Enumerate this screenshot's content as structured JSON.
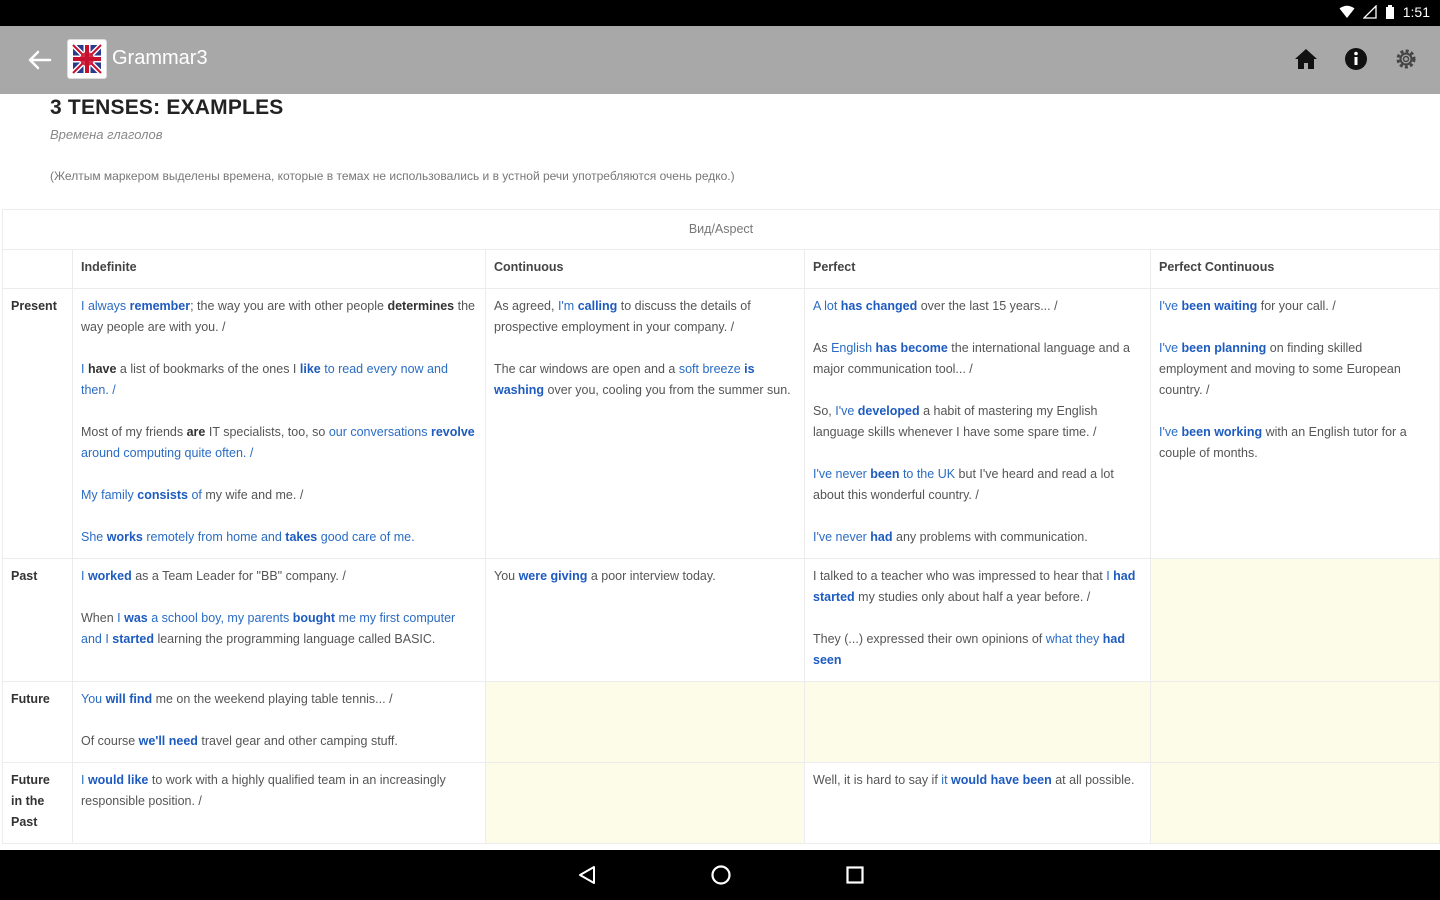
{
  "status": {
    "time": "1:51"
  },
  "appbar": {
    "title": "Grammar3"
  },
  "page": {
    "title": "3 TENSES: EXAMPLES",
    "subtitle": "Времена глаголов",
    "note": "(Желтым маркером выделены времена, которые в темах не использовались и в устной речи употребляются очень редко.)"
  },
  "table": {
    "aspect_header": "Вид/Aspect",
    "columns": [
      "Indefinite",
      "Continuous",
      "Perfect",
      "Perfect Continuous"
    ],
    "rows": [
      {
        "label": "Present",
        "cells": [
          [
            [
              [
                "b",
                "I always "
              ],
              [
                "bb",
                "remember"
              ],
              [
                "",
                "; the way you are with other people "
              ],
              [
                "k",
                "determines"
              ],
              [
                "",
                "",
                " the way people are with you. /"
              ]
            ],
            [
              [
                "b",
                "I "
              ],
              [
                "k",
                "have"
              ],
              [
                "",
                "",
                " a list of bookmarks of the ones I "
              ],
              [
                "bb",
                "like"
              ],
              [
                "b",
                " to read every now and then. /"
              ]
            ],
            [
              [
                "",
                "Most of my friends "
              ],
              [
                "k",
                "are"
              ],
              [
                "",
                "",
                " IT specialists, too, so "
              ],
              [
                "b",
                "our conversations "
              ],
              [
                "bb",
                "revolve"
              ],
              [
                "b",
                " around computing quite often. /"
              ]
            ],
            [
              [
                "b",
                "My family "
              ],
              [
                "bb",
                "consists"
              ],
              [
                "b",
                " of"
              ],
              [
                "",
                "",
                " my wife and me. /"
              ]
            ],
            [
              [
                "b",
                "She "
              ],
              [
                "bb",
                "works"
              ],
              [
                "b",
                " remotely from home and "
              ],
              [
                "bb",
                "takes"
              ],
              [
                "b",
                " good care of me."
              ]
            ]
          ],
          [
            [
              [
                "",
                "As agreed, "
              ],
              [
                "b",
                "I'm "
              ],
              [
                "bb",
                "calling"
              ],
              [
                "",
                "",
                " to discuss the details of prospective employment in your company. /"
              ]
            ],
            [
              [
                "",
                "The car windows are open and a "
              ],
              [
                "b",
                "soft breeze "
              ],
              [
                "bb",
                "is washing"
              ],
              [
                "",
                "",
                " over you, cooling you from the summer sun."
              ]
            ]
          ],
          [
            [
              [
                "b",
                "A lot "
              ],
              [
                "bb",
                "has changed"
              ],
              [
                "",
                "",
                " over the last 15 years... /"
              ]
            ],
            [
              [
                "",
                "As "
              ],
              [
                "b",
                "English "
              ],
              [
                "bb",
                "has become"
              ],
              [
                "",
                "",
                " the international language and a major communication tool... /"
              ]
            ],
            [
              [
                "",
                "So, "
              ],
              [
                "b",
                "I've "
              ],
              [
                "bb",
                "developed"
              ],
              [
                "",
                "",
                " a habit of mastering my English language skills whenever I have some spare time. /"
              ]
            ],
            [
              [
                "b",
                "I've never "
              ],
              [
                "bb",
                "been"
              ],
              [
                "b",
                " to the UK"
              ],
              [
                "",
                "",
                " but I've heard and read a lot about this wonderful country. /"
              ]
            ],
            [
              [
                "b",
                "I've never "
              ],
              [
                "bb",
                "had"
              ],
              [
                "",
                "",
                " any problems with communication."
              ]
            ]
          ],
          [
            [
              [
                "b",
                "I've "
              ],
              [
                "bb",
                "been waiting"
              ],
              [
                "",
                "",
                " for your call. /"
              ]
            ],
            [
              [
                "b",
                "I've "
              ],
              [
                "bb",
                "been planning"
              ],
              [
                "",
                "",
                " on finding skilled employment and moving to some European country. /"
              ]
            ],
            [
              [
                "b",
                "I've "
              ],
              [
                "bb",
                "been working"
              ],
              [
                "",
                "",
                " with an English tutor for a couple of months."
              ]
            ]
          ]
        ],
        "yellow": [
          false,
          false,
          false,
          false
        ]
      },
      {
        "label": "Past",
        "cells": [
          [
            [
              [
                "b",
                "I "
              ],
              [
                "bb",
                "worked"
              ],
              [
                "",
                "",
                " as a Team Leader for \"BB\" company. /"
              ]
            ],
            [
              [
                "",
                "When "
              ],
              [
                "b",
                "I "
              ],
              [
                "bb",
                "was"
              ],
              [
                "b",
                " a school boy, my parents "
              ],
              [
                "bb",
                "bought"
              ],
              [
                "b",
                " me my first computer and I "
              ],
              [
                "bb",
                "started"
              ],
              [
                "",
                "",
                " learning the programming language called BASIC."
              ]
            ]
          ],
          [
            [
              [
                "",
                "You "
              ],
              [
                "bb",
                "were giving"
              ],
              [
                "",
                "",
                " a poor interview today."
              ]
            ]
          ],
          [
            [
              [
                "",
                "I talked to a teacher who was impressed to hear that "
              ],
              [
                "b",
                "I "
              ],
              [
                "bb",
                "had started"
              ],
              [
                "",
                "",
                " my studies only about half a year before. /"
              ]
            ],
            [
              [
                "",
                "They (...) expressed their own opinions of "
              ],
              [
                "b",
                "what they "
              ],
              [
                "bb",
                "had seen"
              ]
            ]
          ],
          []
        ],
        "yellow": [
          false,
          false,
          false,
          true
        ]
      },
      {
        "label": "Future",
        "cells": [
          [
            [
              [
                "b",
                "You "
              ],
              [
                "bb",
                "will find"
              ],
              [
                "",
                "",
                " me on the weekend playing table tennis... /"
              ]
            ],
            [
              [
                "",
                "Of course "
              ],
              [
                "bb",
                "we'll need"
              ],
              [
                "",
                "",
                " travel gear and other camping stuff."
              ]
            ]
          ],
          [],
          [],
          []
        ],
        "yellow": [
          false,
          true,
          true,
          true
        ]
      },
      {
        "label": "Future in the Past",
        "cells": [
          [
            [
              [
                "b",
                "I "
              ],
              [
                "bb",
                "would like"
              ],
              [
                "",
                "",
                " to work with a highly qualified team in an increasingly responsible position. /"
              ]
            ]
          ],
          [],
          [
            [
              [
                "",
                "Well, it is hard to say if "
              ],
              [
                "b",
                "it "
              ],
              [
                "bb",
                "would have been"
              ],
              [
                "",
                "",
                " at all possible."
              ]
            ]
          ],
          []
        ],
        "yellow": [
          false,
          true,
          false,
          true
        ]
      }
    ]
  },
  "icons": {
    "back": "arrow-back-icon",
    "home": "home-icon",
    "info": "info-icon",
    "settings": "gear-icon",
    "nav_back": "nav-back-icon",
    "nav_home": "nav-home-icon",
    "nav_recents": "nav-recents-icon"
  }
}
